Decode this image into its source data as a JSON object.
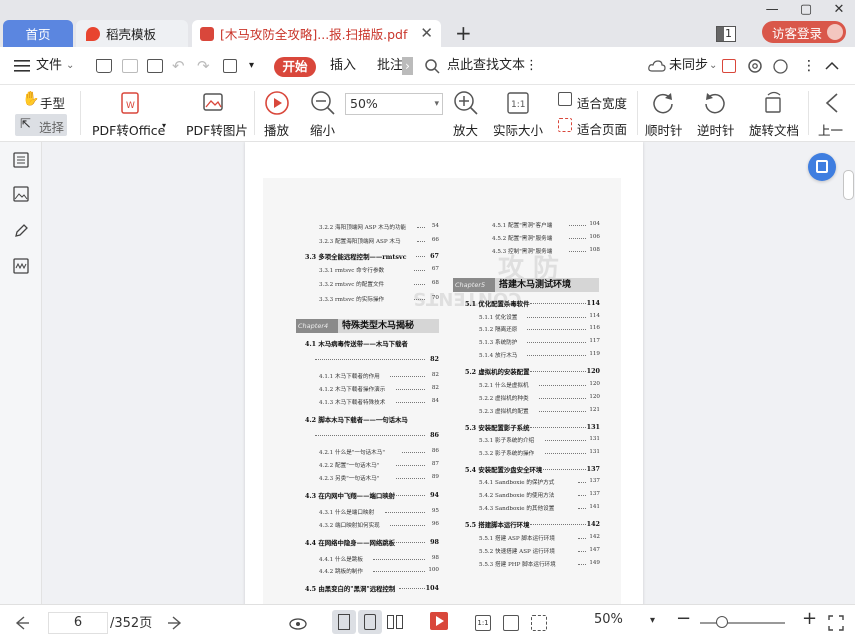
{
  "window": {
    "controls": [
      "—",
      "▢",
      "✕"
    ]
  },
  "tabs": [
    {
      "label": "首页",
      "active": false
    },
    {
      "label": "稻壳模板",
      "active": false
    },
    {
      "label": "[木马攻防全攻略]...报.扫描版.pdf",
      "active": true,
      "close": "✕"
    }
  ],
  "tab_add": "+",
  "page_badge": "1",
  "visitor_login": "访客登录",
  "menu": {
    "file": "文件",
    "start": "开始",
    "insert": "插入",
    "annotate": "批注",
    "more": "›",
    "search": "点此查找文本",
    "kebab": "⋮",
    "sync": "未同步",
    "collapse": "^"
  },
  "ribbon": {
    "hand": "手型",
    "select": "选择",
    "pdf_to_office": "PDF转Office",
    "pdf_to_image": "PDF转图片",
    "play": "播放",
    "zoom_out": "缩小",
    "zoom_value": "50%",
    "zoom_in": "放大",
    "actual_size": "实际大小",
    "fit_width": "适合宽度",
    "fit_page": "适合页面",
    "rotate_cw": "顺时针",
    "rotate_ccw": "逆时针",
    "rotate_doc": "旋转文档",
    "prev_page": "上一"
  },
  "toc_left": [
    {
      "num": "3.2.2",
      "text": "海阳顶端网 ASP 木马的功能",
      "page": "54",
      "level": 2
    },
    {
      "num": "3.2.3",
      "text": "配置海阳顶端网 ASP 木马",
      "page": "66",
      "level": 2
    },
    {
      "num": "3.3",
      "text": "多项全能远程控制——rmtsvc",
      "page": "67",
      "level": 1
    },
    {
      "num": "3.3.1",
      "text": "rmtsvc 命令行参数",
      "page": "67",
      "level": 2
    },
    {
      "num": "3.3.2",
      "text": "rmtsvc 的配置文件",
      "page": "68",
      "level": 2
    },
    {
      "num": "3.3.3",
      "text": "rmtsvc 的实际操作",
      "page": "70",
      "level": 2
    }
  ],
  "chapter4": {
    "tag": "Chapter4",
    "title": "特殊类型木马揭秘"
  },
  "toc_left2": [
    {
      "num": "4.1",
      "text": "木马病毒传送带——木马下载者",
      "page": "",
      "level": 1
    },
    {
      "num": "",
      "text": "",
      "page": "82",
      "level": 1
    },
    {
      "num": "4.1.1",
      "text": "木马下载者的作用",
      "page": "82",
      "level": 2
    },
    {
      "num": "4.1.2",
      "text": "木马下载者操作演示",
      "page": "82",
      "level": 2
    },
    {
      "num": "4.1.3",
      "text": "木马下载者特殊技术",
      "page": "84",
      "level": 2
    },
    {
      "num": "4.2",
      "text": "脚本木马下载者——一句话木马",
      "page": "",
      "level": 1
    },
    {
      "num": "",
      "text": "",
      "page": "86",
      "level": 1
    },
    {
      "num": "4.2.1",
      "text": "什么是\"一句话木马\"",
      "page": "86",
      "level": 2
    },
    {
      "num": "4.2.2",
      "text": "配置\"一句话木马\"",
      "page": "87",
      "level": 2
    },
    {
      "num": "4.2.3",
      "text": "另类\"一句话木马\"",
      "page": "89",
      "level": 2
    },
    {
      "num": "4.3",
      "text": "在内网中飞翔——端口映射",
      "page": "94",
      "level": 1
    },
    {
      "num": "4.3.1",
      "text": "什么是端口映射",
      "page": "95",
      "level": 2
    },
    {
      "num": "4.3.2",
      "text": "端口映射如何实现",
      "page": "96",
      "level": 2
    },
    {
      "num": "4.4",
      "text": "在网络中隐身——网络跳板",
      "page": "98",
      "level": 1
    },
    {
      "num": "4.4.1",
      "text": "什么是跳板",
      "page": "98",
      "level": 2
    },
    {
      "num": "4.4.2",
      "text": "跳板的制作",
      "page": "100",
      "level": 2
    },
    {
      "num": "4.5",
      "text": "由黑变白的\"黑洞\"远程控制",
      "page": "104",
      "level": 1
    }
  ],
  "toc_right": [
    {
      "num": "4.5.1",
      "text": "配置\"黑洞\"客户端",
      "page": "104",
      "level": 2
    },
    {
      "num": "4.5.2",
      "text": "配置\"黑洞\"服务端",
      "page": "106",
      "level": 2
    },
    {
      "num": "4.5.3",
      "text": "控制\"黑洞\"服务端",
      "page": "108",
      "level": 2
    }
  ],
  "chapter5": {
    "tag": "Chapter5",
    "title": "搭建木马测试环境"
  },
  "toc_right2": [
    {
      "num": "5.1",
      "text": "优化配置杀毒软件",
      "page": "114",
      "level": 1
    },
    {
      "num": "5.1.1",
      "text": "优化设置",
      "page": "114",
      "level": 2
    },
    {
      "num": "5.1.2",
      "text": "隔离还原",
      "page": "116",
      "level": 2
    },
    {
      "num": "5.1.3",
      "text": "系统防护",
      "page": "117",
      "level": 2
    },
    {
      "num": "5.1.4",
      "text": "放行木马",
      "page": "119",
      "level": 2
    },
    {
      "num": "5.2",
      "text": "虚拟机的安装配置",
      "page": "120",
      "level": 1
    },
    {
      "num": "5.2.1",
      "text": "什么是虚拟机",
      "page": "120",
      "level": 2
    },
    {
      "num": "5.2.2",
      "text": "虚拟机的种类",
      "page": "120",
      "level": 2
    },
    {
      "num": "5.2.3",
      "text": "虚拟机的配置",
      "page": "121",
      "level": 2
    },
    {
      "num": "5.3",
      "text": "安装配置影子系统",
      "page": "131",
      "level": 1
    },
    {
      "num": "5.3.1",
      "text": "影子系统的介绍",
      "page": "131",
      "level": 2
    },
    {
      "num": "5.3.2",
      "text": "影子系统的操作",
      "page": "131",
      "level": 2
    },
    {
      "num": "5.4",
      "text": "安装配置沙盘安全环境",
      "page": "137",
      "level": 1
    },
    {
      "num": "5.4.1",
      "text": "Sandboxie 的保护方式",
      "page": "137",
      "level": 2
    },
    {
      "num": "5.4.2",
      "text": "Sandboxie 的使用方法",
      "page": "137",
      "level": 2
    },
    {
      "num": "5.4.3",
      "text": "Sandboxie 的其他设置",
      "page": "141",
      "level": 2
    },
    {
      "num": "5.5",
      "text": "搭建脚本运行环境",
      "page": "142",
      "level": 1
    },
    {
      "num": "5.5.1",
      "text": "搭建 ASP 脚本运行环境",
      "page": "142",
      "level": 2
    },
    {
      "num": "5.5.2",
      "text": "快速搭建 ASP 运行环境",
      "page": "147",
      "level": 2
    },
    {
      "num": "5.5.3",
      "text": "搭建 PHP 脚本运行环境",
      "page": "149",
      "level": 2
    }
  ],
  "status": {
    "current_page": "6",
    "total_pages": "/352页",
    "zoom": "50%",
    "minus": "−",
    "plus": "+"
  },
  "colors": {
    "accent_red": "#d9473b",
    "tab_blue": "#5b86e0",
    "float_blue": "#3f7ee0"
  }
}
